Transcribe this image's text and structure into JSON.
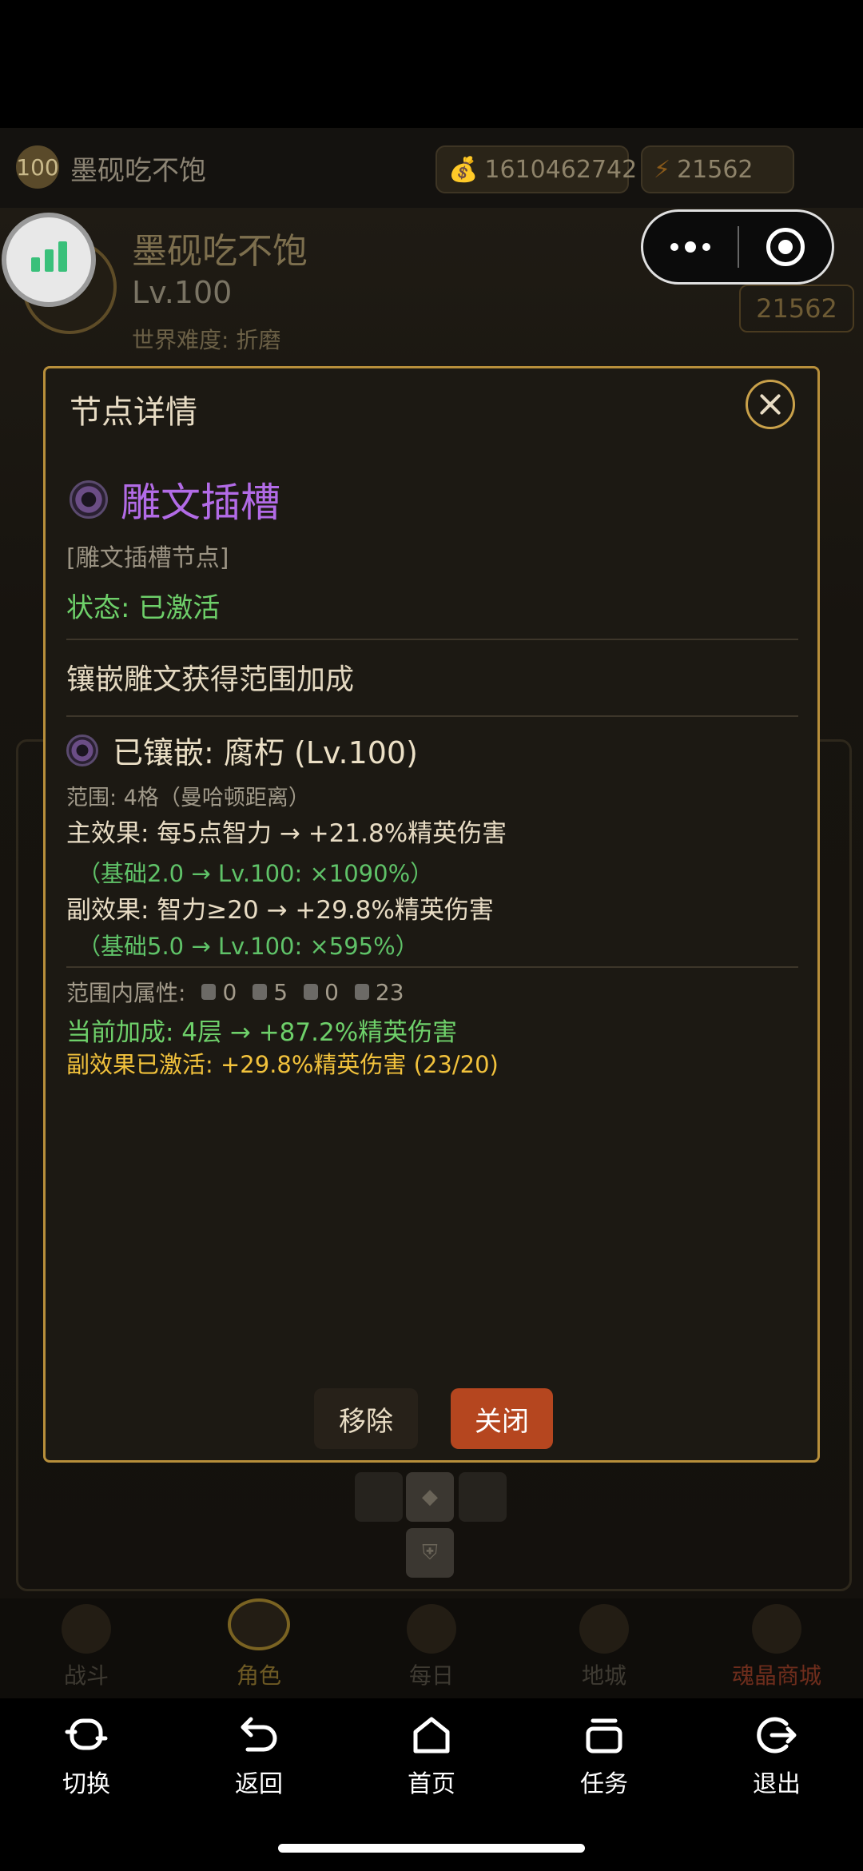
{
  "status_bar": {},
  "game": {
    "top_level": "100",
    "top_name": "墨砚吃不饱",
    "gold": "1610462742",
    "energy": "21562",
    "profile_name": "墨砚吃不饱",
    "profile_level": "Lv.100",
    "profile_difficulty": "世界难度: 折磨",
    "profile_energy": "21562",
    "tabs": [
      {
        "label": "战斗"
      },
      {
        "label": "角色"
      },
      {
        "label": "每日"
      },
      {
        "label": "地城"
      },
      {
        "label": "魂晶商城"
      }
    ]
  },
  "miniprogram_capsule": {
    "more_icon": "more-dots-icon",
    "close_icon": "target-icon"
  },
  "modal": {
    "title": "节点详情",
    "node_name": "雕文插槽",
    "node_type": "[雕文插槽节点]",
    "status": "状态: 已激活",
    "description": "镶嵌雕文获得范围加成",
    "slotted": "已镶嵌: 腐朽 (Lv.100)",
    "range": "范围: 4格（曼哈顿距离）",
    "main_effect": "主效果: 每5点智力 → +21.8%精英伤害",
    "main_formula": "（基础2.0 → Lv.100: ×1090%）",
    "sub_effect": "副效果: 智力≥20 → +29.8%精英伤害",
    "sub_formula": "（基础5.0 → Lv.100: ×595%）",
    "attr_label": "范围内属性:",
    "attr_values": [
      "0",
      "5",
      "0",
      "23"
    ],
    "current_bonus": "当前加成: 4层 → +87.2%精英伤害",
    "sub_active": "副效果已激活: +29.8%精英伤害 (23/20)",
    "remove_label": "移除",
    "close_label": "关闭"
  },
  "system_nav": {
    "items": [
      {
        "label": "切换",
        "icon": "switch-icon"
      },
      {
        "label": "返回",
        "icon": "back-icon"
      },
      {
        "label": "首页",
        "icon": "home-icon"
      },
      {
        "label": "任务",
        "icon": "tasks-icon"
      },
      {
        "label": "退出",
        "icon": "exit-icon"
      }
    ]
  },
  "colors": {
    "accent_gold": "#b88f3b",
    "purple": "#b26be6",
    "green": "#6ed06a",
    "yellow": "#f2c23c",
    "button_orange": "#b5461f"
  }
}
